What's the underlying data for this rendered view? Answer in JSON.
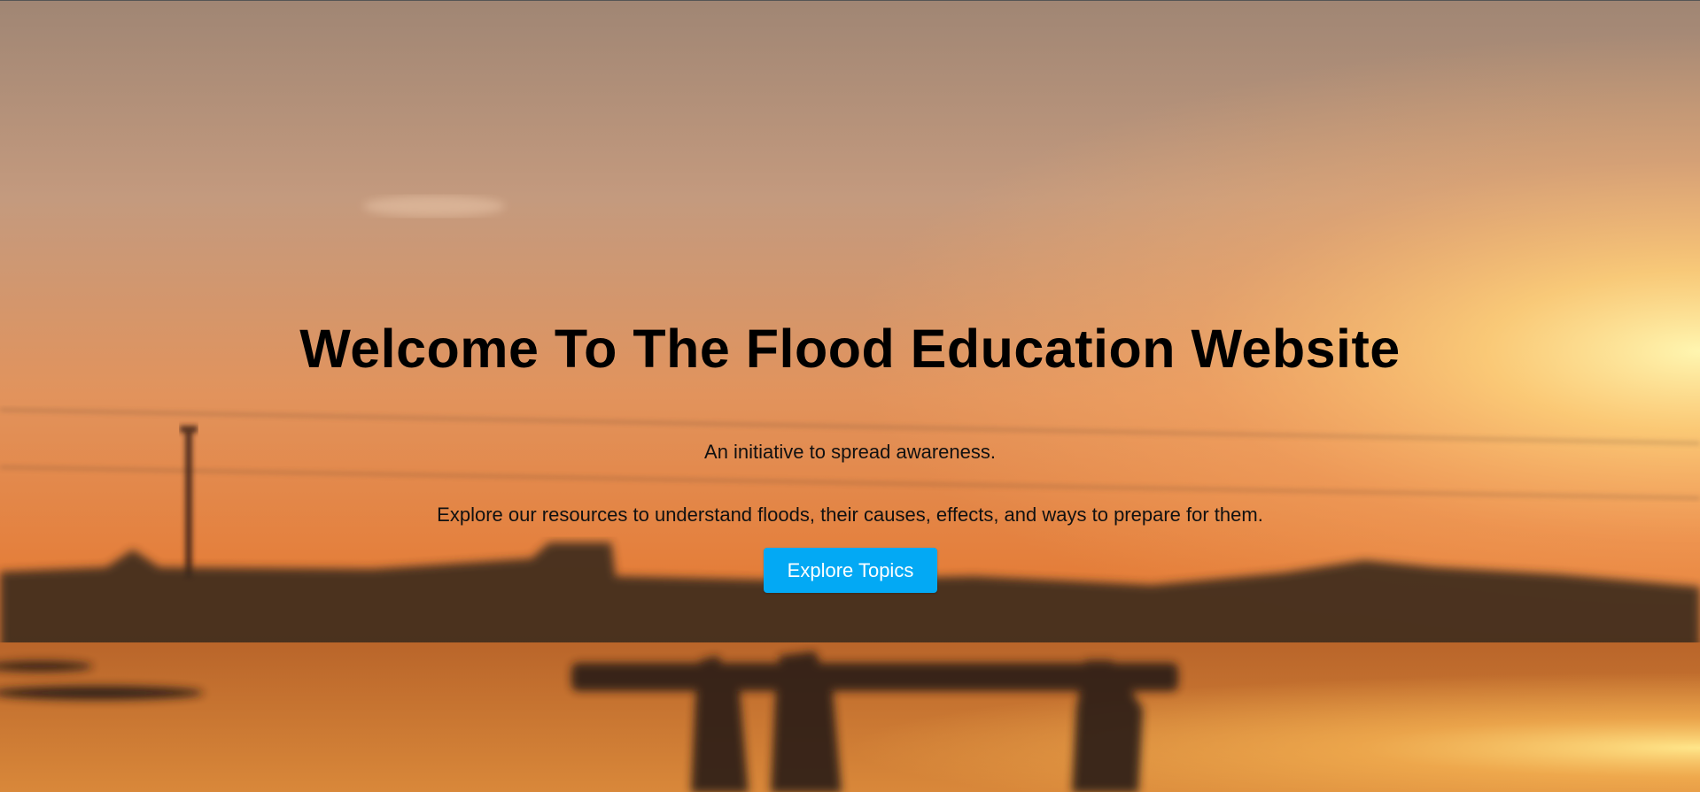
{
  "hero": {
    "title": "Welcome To The Flood Education Website",
    "tagline": "An initiative to spread awareness.",
    "description": "Explore our resources to understand floods, their causes, effects, and ways to prepare for them.",
    "cta_label": "Explore Topics"
  },
  "colors": {
    "cta_background": "#03a9f4",
    "cta_text": "#ffffff",
    "heading_text": "#000000"
  }
}
